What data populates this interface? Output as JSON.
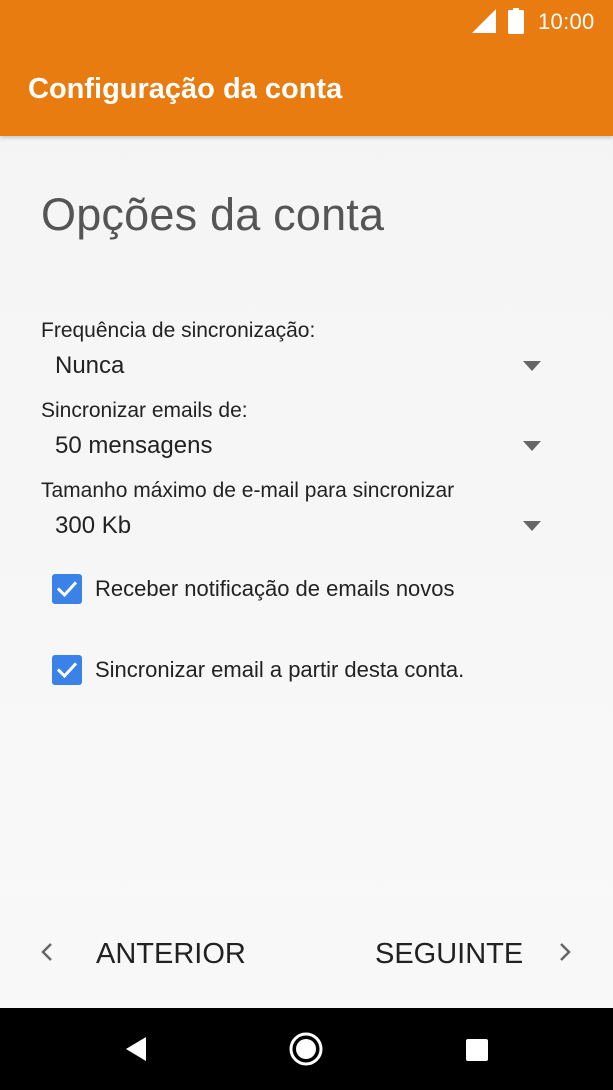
{
  "status_bar": {
    "time": "10:00",
    "icons": [
      "signal-icon",
      "battery-icon"
    ]
  },
  "app_bar": {
    "title": "Configuração da conta"
  },
  "page": {
    "title": "Opções da conta"
  },
  "fields": [
    {
      "label": "Frequência de sincronização:",
      "value": "Nunca"
    },
    {
      "label": "Sincronizar emails de:",
      "value": "50 mensagens"
    },
    {
      "label": "Tamanho máximo de e-mail para sincronizar",
      "value": "300 Kb"
    }
  ],
  "checkboxes": [
    {
      "label": "Receber notificação de emails novos",
      "checked": true
    },
    {
      "label": "Sincronizar email a partir desta conta.",
      "checked": true
    }
  ],
  "wizard": {
    "prev_label": "ANTERIOR",
    "next_label": "SEGUINTE"
  },
  "system_nav": {
    "icons": [
      "back-icon",
      "home-icon",
      "recents-icon"
    ]
  },
  "colors": {
    "accent": "#e87c10",
    "checkbox": "#3b82e8"
  }
}
